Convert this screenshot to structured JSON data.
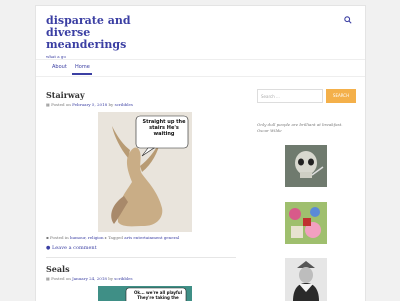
{
  "site": {
    "title": "disparate and diverse meanderings",
    "tagline": "what a go"
  },
  "nav": {
    "items": [
      "About",
      "Home"
    ]
  },
  "posts": [
    {
      "title": "Stairway",
      "posted_prefix": "Posted on",
      "date": "February 5, 2018",
      "by": "by",
      "author": "scribbles",
      "speech_bubble": "Straight up the stairs He's waiting",
      "posted_in_prefix": "Posted in",
      "categories": "humour, religion",
      "tagged_prefix": "Tagged",
      "tags": "arts entertainment general",
      "comment_label": "Leave a comment"
    },
    {
      "title": "Seals",
      "posted_prefix": "Posted on",
      "date": "January 24, 2018",
      "by": "by",
      "author": "scribbles",
      "speech_bubble": "Ok... we're all playful They're taking the"
    }
  ],
  "sidebar": {
    "search_placeholder": "Search ...",
    "search_button": "SEARCH",
    "quote": "Only dull people are brilliant at breakfast. Oscar Wilde"
  },
  "colors": {
    "accent": "#3b3fa3",
    "button": "#f4b04a"
  }
}
